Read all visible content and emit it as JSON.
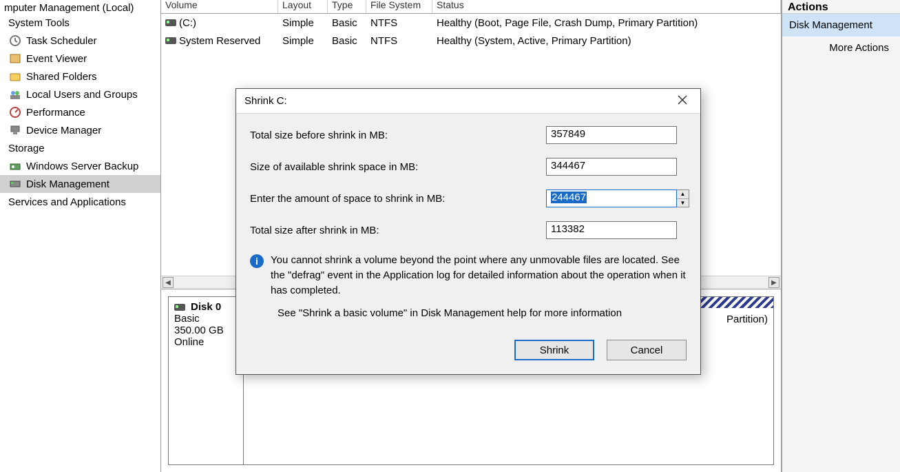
{
  "tree": {
    "root_cut": "mputer Management (Local)",
    "system_tools": "System Tools",
    "items_sys": [
      {
        "label": "Task Scheduler",
        "icon": "clock"
      },
      {
        "label": "Event Viewer",
        "icon": "event"
      },
      {
        "label": "Shared Folders",
        "icon": "folder"
      },
      {
        "label": "Local Users and Groups",
        "icon": "users"
      },
      {
        "label": "Performance",
        "icon": "perf"
      },
      {
        "label": "Device Manager",
        "icon": "device"
      }
    ],
    "storage": "Storage",
    "items_storage": [
      {
        "label": "Windows Server Backup",
        "icon": "backup"
      },
      {
        "label": "Disk Management",
        "icon": "disk",
        "selected": true
      }
    ],
    "services": "Services and Applications"
  },
  "vol_header": [
    "Volume",
    "Layout",
    "Type",
    "File System",
    "Status"
  ],
  "volumes": [
    {
      "name": "(C:)",
      "layout": "Simple",
      "type": "Basic",
      "fs": "NTFS",
      "status": "Healthy (Boot, Page File, Crash Dump, Primary Partition)"
    },
    {
      "name": "System Reserved",
      "layout": "Simple",
      "type": "Basic",
      "fs": "NTFS",
      "status": "Healthy (System, Active, Primary Partition)"
    }
  ],
  "disk": {
    "title": "Disk 0",
    "type": "Basic",
    "size": "350.00 GB",
    "state": "Online",
    "vol_partition": "Partition)"
  },
  "actions": {
    "header": "Actions",
    "item": "Disk Management",
    "sub": "More Actions"
  },
  "dialog": {
    "title": "Shrink C:",
    "rows": {
      "before_label": "Total size before shrink in MB:",
      "before_value": "357849",
      "avail_label": "Size of available shrink space in MB:",
      "avail_value": "344467",
      "enter_label": "Enter the amount of space to shrink in MB:",
      "enter_value": "244467",
      "after_label": "Total size after shrink in MB:",
      "after_value": "113382"
    },
    "info": "You cannot shrink a volume beyond the point where any unmovable files are located. See the \"defrag\" event in the Application log for detailed information about the operation when it has completed.",
    "help": "See \"Shrink a basic volume\" in Disk Management help for more information",
    "shrink_btn": "Shrink",
    "cancel_btn": "Cancel"
  }
}
